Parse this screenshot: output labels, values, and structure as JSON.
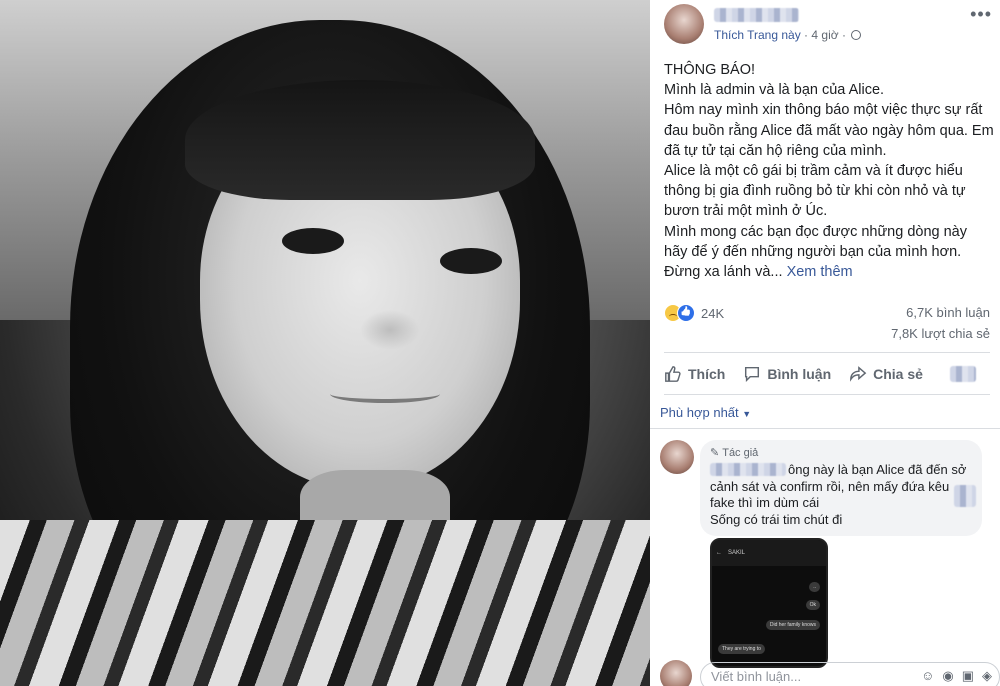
{
  "post": {
    "meta_like_page": "Thích Trang này",
    "meta_sep": " · ",
    "meta_time": "4 giờ",
    "more_label": "•••",
    "text_lines": [
      "THÔNG BÁO!",
      "Mình là admin và là bạn của Alice.",
      "Hôm nay mình xin thông báo một việc thực sự rất đau buồn rằng Alice đã mất vào ngày hôm qua. Em đã tự tử tại căn hộ riêng của mình.",
      "Alice là một cô gái bị trầm cảm và ít được hiểu thông bị gia đình ruồng bỏ từ khi còn nhỏ và tự bươn trải một mình ở Úc.",
      "Mình mong các bạn đọc được những dòng này hãy để ý đến những người bạn của mình hơn. Đừng xa lánh và..."
    ],
    "see_more": "Xem thêm",
    "reaction_count": "24K",
    "comments_count": "6,7K bình luận",
    "shares_count": "7,8K lượt chia sẻ"
  },
  "actions": {
    "like": "Thích",
    "comment": "Bình luận",
    "share": "Chia sẻ"
  },
  "comments": {
    "sort_label": "Phù hợp nhất",
    "first": {
      "badge": "Tác giả",
      "text_after_name": "ông này là bạn Alice đã đến sở cảnh sát và confirm rồi, nên mấy đứa kêu fake thì im dùm cái",
      "line2": "Sống có trái tim chút đi",
      "attachment": {
        "contact": "SAKIL",
        "bubble1": "..",
        "bubble2": "Ok",
        "bubble3": "Did her family knows",
        "bubble4": "They are trying to"
      }
    },
    "compose_placeholder": "Viết bình luận..."
  },
  "colors": {
    "link": "#385898",
    "secondary_text": "#606770",
    "like_blue": "#2e6fe8",
    "sad_yellow": "#f7c845"
  }
}
